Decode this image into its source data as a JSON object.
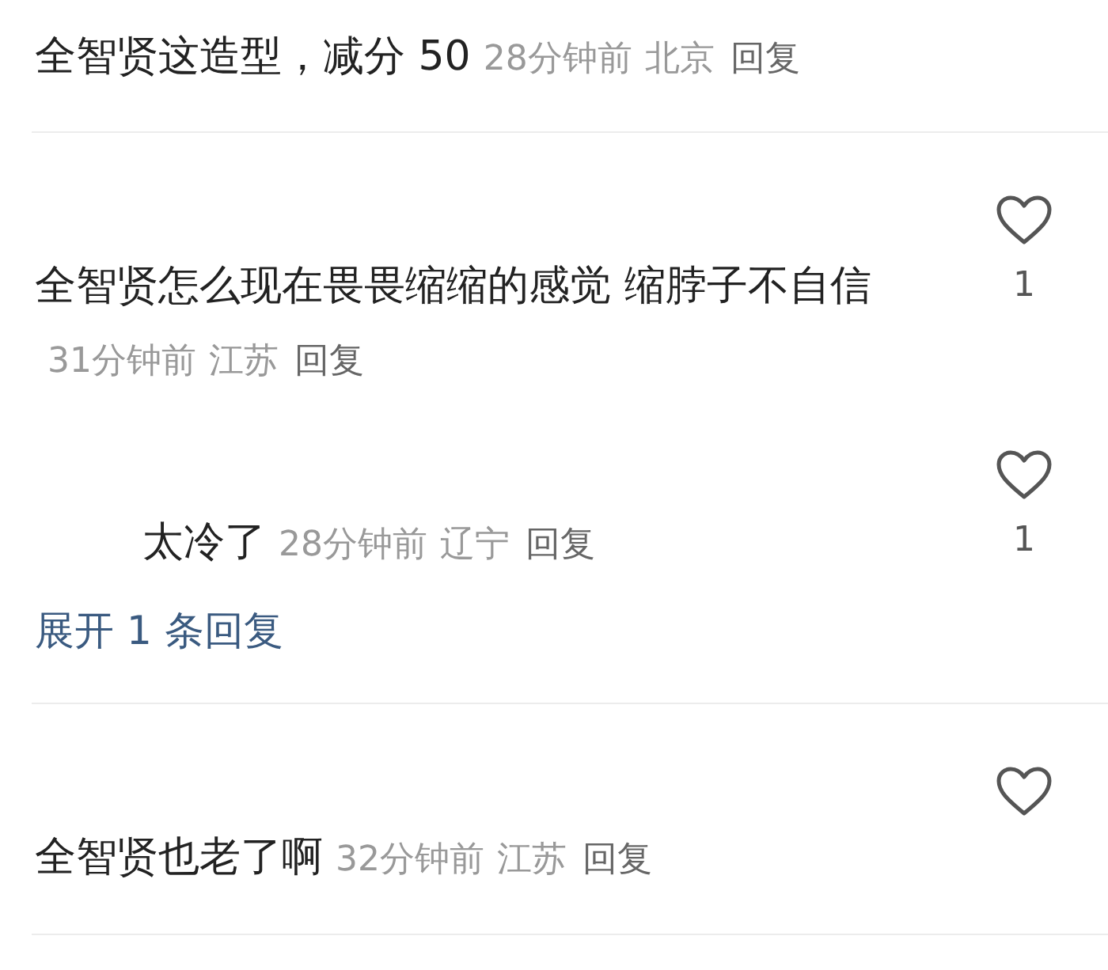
{
  "comments": [
    {
      "text": "全智贤这造型，减分 50",
      "time": "28分钟前",
      "location": "北京",
      "reply_link": "回复",
      "heart_shown": false
    },
    {
      "text": "全智贤怎么现在畏畏缩缩的感觉 缩脖子不自信",
      "time": "31分钟前",
      "location": "江苏",
      "reply_link": "回复",
      "heart_shown": true,
      "like_count": "1",
      "replies": [
        {
          "text": "太冷了",
          "time": "28分钟前",
          "location": "辽宁",
          "reply_link": "回复",
          "heart_shown": true,
          "like_count": "1"
        }
      ],
      "expand_link": "展开 1 条回复"
    },
    {
      "text": "全智贤也老了啊",
      "time": "32分钟前",
      "location": "江苏",
      "reply_link": "回复",
      "heart_shown": true
    }
  ]
}
